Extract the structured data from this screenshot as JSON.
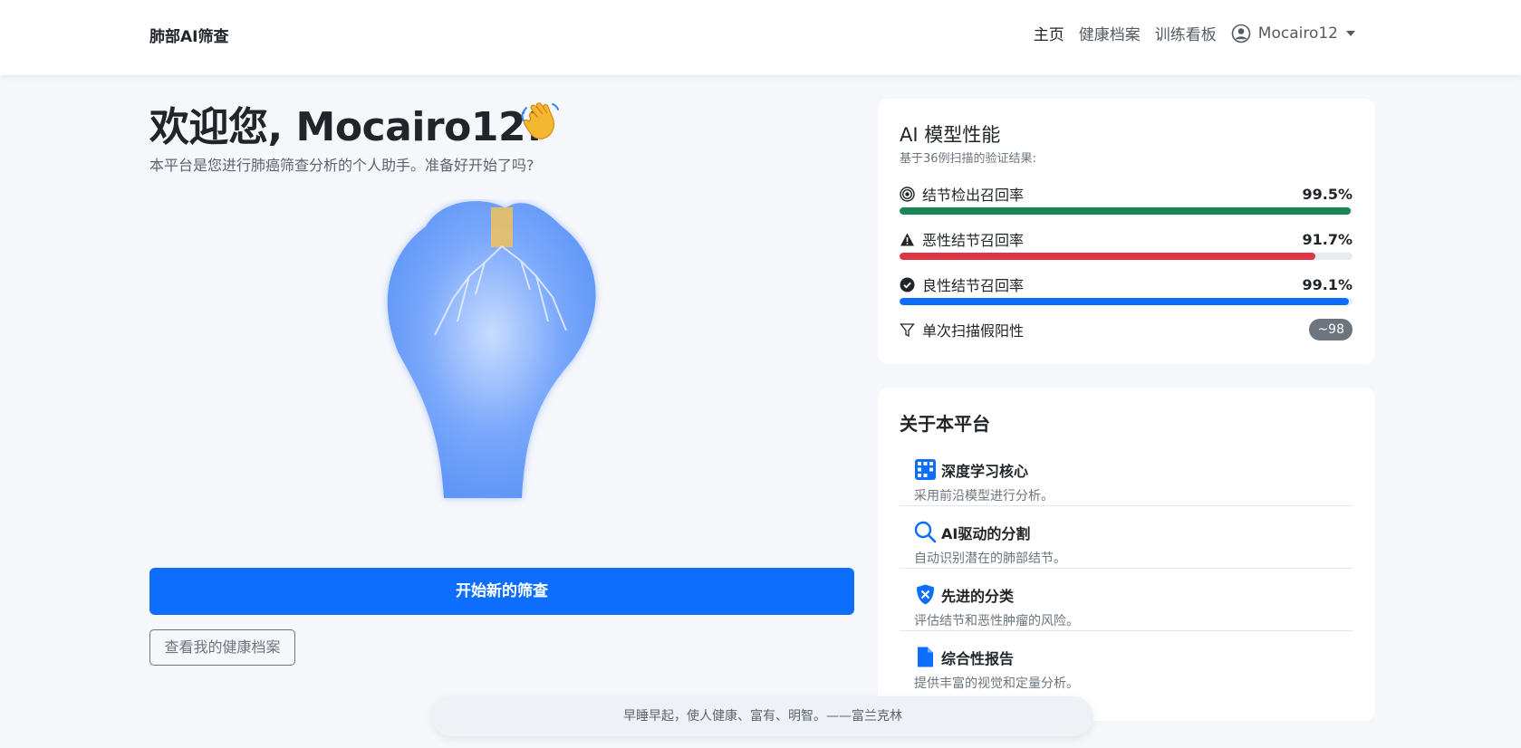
{
  "nav": {
    "brand": "肺部AI筛查",
    "links": [
      "主页",
      "健康档案",
      "训练看板"
    ],
    "user": "Mocairo12"
  },
  "hero": {
    "welcome": "欢迎您, Mocairo12!",
    "subtitle": "本平台是您进行肺癌筛查分析的个人助手。准备好开始了吗?",
    "start_button": "开始新的筛查",
    "health_button": "查看我的健康档案"
  },
  "performance": {
    "title": "AI 模型性能",
    "subtitle": "基于36例扫描的验证结果:",
    "metrics": [
      {
        "label": "结节检出召回率",
        "value": "99.5%",
        "fill": 0.995,
        "color": "#198754",
        "icon": "bullseye-icon"
      },
      {
        "label": "恶性结节召回率",
        "value": "91.7%",
        "fill": 0.917,
        "color": "#dc3545",
        "icon": "warning-icon"
      },
      {
        "label": "良性结节召回率",
        "value": "99.1%",
        "fill": 0.991,
        "color": "#0d6efd",
        "icon": "check-circle-icon"
      }
    ],
    "false_positive": {
      "label": "单次扫描假阳性",
      "value": "~98",
      "icon": "filter-icon"
    }
  },
  "about": {
    "title": "关于本平台",
    "features": [
      {
        "title": "深度学习核心",
        "desc": "采用前沿模型进行分析。",
        "icon": "grid-icon"
      },
      {
        "title": "AI驱动的分割",
        "desc": "自动识别潜在的肺部结节。",
        "icon": "search-icon"
      },
      {
        "title": "先进的分类",
        "desc": "评估结节和恶性肿瘤的风险。",
        "icon": "shield-icon"
      },
      {
        "title": "综合性报告",
        "desc": "提供丰富的视觉和定量分析。",
        "icon": "document-icon"
      }
    ]
  },
  "quote": "早睡早起，使人健康、富有、明智。——富兰克林"
}
